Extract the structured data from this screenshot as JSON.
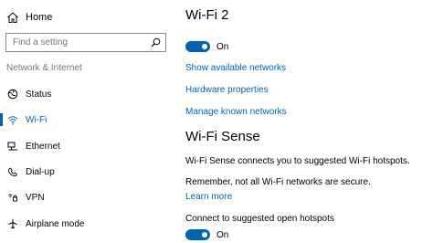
{
  "sidebar": {
    "home_label": "Home",
    "search_placeholder": "Find a setting",
    "section_label": "Network & Internet",
    "items": [
      {
        "label": "Status",
        "icon": "globe-icon"
      },
      {
        "label": "Wi-Fi",
        "icon": "wifi-icon",
        "selected": true
      },
      {
        "label": "Ethernet",
        "icon": "ethernet-icon"
      },
      {
        "label": "Dial-up",
        "icon": "dialup-icon"
      },
      {
        "label": "VPN",
        "icon": "vpn-icon"
      },
      {
        "label": "Airplane mode",
        "icon": "airplane-icon"
      }
    ]
  },
  "main": {
    "title": "Wi-Fi 2",
    "wifi_toggle": {
      "state": "On",
      "on": true
    },
    "links": {
      "show_networks": "Show available networks",
      "hardware": "Hardware properties",
      "manage": "Manage known networks"
    },
    "wifi_sense": {
      "title": "Wi-Fi Sense",
      "description": "Wi-Fi Sense connects you to suggested Wi-Fi hotspots.",
      "remember": "Remember, not all Wi-Fi networks are secure.",
      "learn_more": "Learn more",
      "connect_label": "Connect to suggested open hotspots",
      "connect_toggle": {
        "state": "On",
        "on": true
      }
    }
  },
  "colors": {
    "accent": "#0063b1",
    "secondary_text": "#767676"
  }
}
